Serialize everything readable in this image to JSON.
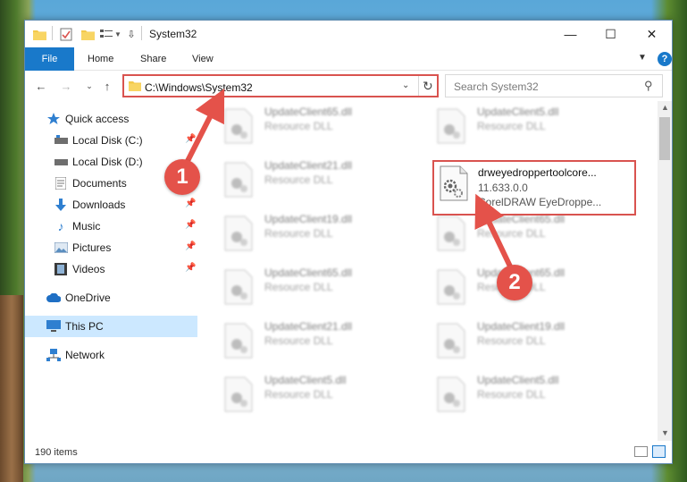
{
  "window": {
    "title": "System32",
    "controls": {
      "minimize": "—",
      "maximize": "☐",
      "close": "✕"
    }
  },
  "ribbon": {
    "tabs": [
      {
        "label": "File"
      },
      {
        "label": "Home"
      },
      {
        "label": "Share"
      },
      {
        "label": "View"
      }
    ],
    "help": "?"
  },
  "address_bar": {
    "path": "C:\\Windows\\System32"
  },
  "search": {
    "placeholder": "Search System32"
  },
  "sidebar": {
    "items": [
      {
        "label": "Quick access",
        "icon": "star-icon"
      },
      {
        "label": "Local Disk (C:)",
        "icon": "drive-icon",
        "pinned": true
      },
      {
        "label": "Local Disk (D:)",
        "icon": "drive-icon",
        "pinned": false
      },
      {
        "label": "Documents",
        "icon": "documents-icon",
        "pinned": true
      },
      {
        "label": "Downloads",
        "icon": "download-icon",
        "pinned": true
      },
      {
        "label": "Music",
        "icon": "music-icon",
        "pinned": true
      },
      {
        "label": "Pictures",
        "icon": "pictures-icon",
        "pinned": true
      },
      {
        "label": "Videos",
        "icon": "videos-icon",
        "pinned": true
      },
      {
        "label": "OneDrive",
        "icon": "cloud-icon"
      },
      {
        "label": "This PC",
        "icon": "computer-icon",
        "selected": true
      },
      {
        "label": "Network",
        "icon": "network-icon"
      }
    ]
  },
  "files": {
    "left_column": [
      {
        "name": "UpdateClient65.dll",
        "type": "Resource DLL"
      },
      {
        "name": "UpdateClient21.dll",
        "type": "Resource DLL"
      },
      {
        "name": "UpdateClient19.dll",
        "type": "Resource DLL"
      },
      {
        "name": "UpdateClient65.dll",
        "type": "Resource DLL"
      },
      {
        "name": "UpdateClient21.dll",
        "type": "Resource DLL"
      },
      {
        "name": "UpdateClient5.dll",
        "type": "Resource DLL"
      }
    ],
    "right_column": [
      {
        "name": "UpdateClient5.dll",
        "type": "Resource DLL"
      },
      {
        "name": "drweyedroppertoolcore...",
        "version": "11.633.0.0",
        "type": "CorelDRAW EyeDroppe...",
        "highlighted": true
      },
      {
        "name": "UpdateClient65.dll",
        "type": "Resource DLL"
      },
      {
        "name": "UpdateClient65.dll",
        "type": "Resource DLL"
      },
      {
        "name": "UpdateClient19.dll",
        "type": "Resource DLL"
      },
      {
        "name": "UpdateClient5.dll",
        "type": "Resource DLL"
      }
    ]
  },
  "status_bar": {
    "item_count": "190 items"
  },
  "annotations": {
    "step1": "1",
    "step2": "2",
    "color": "#e4524a"
  }
}
